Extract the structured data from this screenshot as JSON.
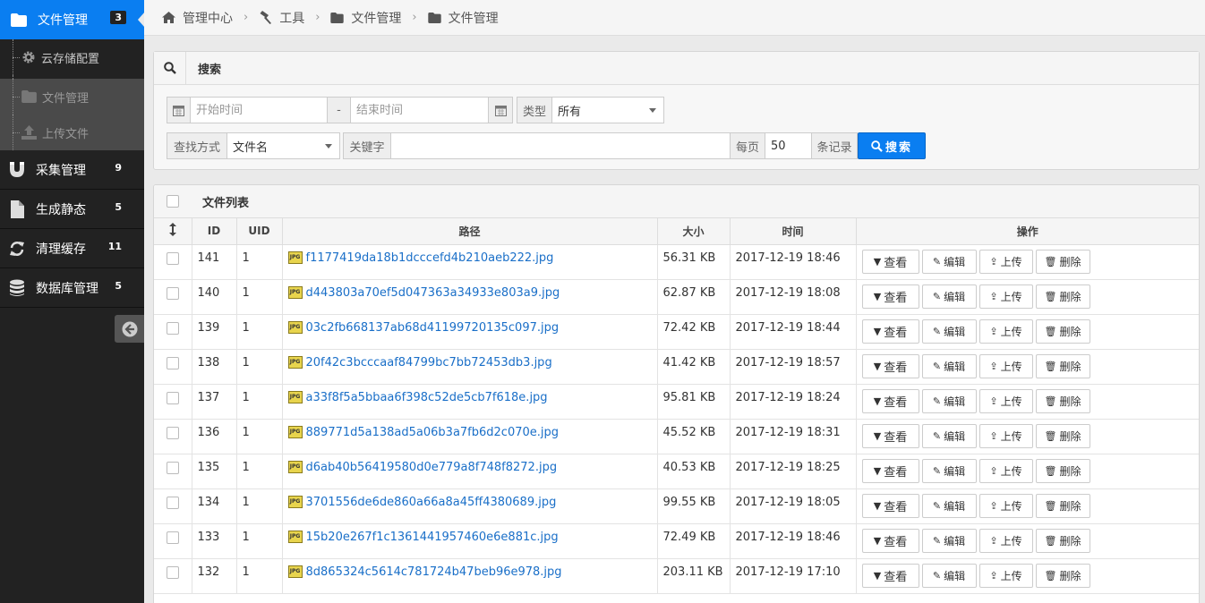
{
  "sidebar": {
    "active": {
      "label": "文件管理",
      "badge": "3"
    },
    "sub_items": [
      {
        "label": "云存储配置",
        "icon": "gear-icon"
      },
      {
        "label": "文件管理",
        "icon": "folder-icon"
      },
      {
        "label": "上传文件",
        "icon": "upload-icon"
      }
    ],
    "items": [
      {
        "label": "采集管理",
        "badge": "9",
        "icon": "magnet-icon"
      },
      {
        "label": "生成静态",
        "badge": "5",
        "icon": "file-icon"
      },
      {
        "label": "清理缓存",
        "badge": "11",
        "icon": "refresh-icon"
      },
      {
        "label": "数据库管理",
        "badge": "5",
        "icon": "database-icon"
      }
    ]
  },
  "breadcrumb": [
    "管理中心",
    "工具",
    "文件管理",
    "文件管理"
  ],
  "search": {
    "title": "搜索",
    "start_placeholder": "开始时间",
    "dash": "-",
    "end_placeholder": "结束时间",
    "type_label": "类型",
    "type_value": "所有",
    "method_label": "查找方式",
    "method_value": "文件名",
    "keyword_label": "关键字",
    "per_page_label": "每页",
    "per_page_value": "50",
    "records_label": "条记录",
    "button": "搜索"
  },
  "list": {
    "title": "文件列表",
    "columns": {
      "id": "ID",
      "uid": "UID",
      "path": "路径",
      "size": "大小",
      "time": "时间",
      "ops": "操作"
    },
    "actions": {
      "view": "查看",
      "edit": "编辑",
      "upload": "上传",
      "delete": "删除"
    },
    "rows": [
      {
        "id": "141",
        "uid": "1",
        "path": "f1177419da18b1dcccefd4b210aeb222.jpg",
        "size": "56.31 KB",
        "time": "2017-12-19 18:46"
      },
      {
        "id": "140",
        "uid": "1",
        "path": "d443803a70ef5d047363a34933e803a9.jpg",
        "size": "62.87 KB",
        "time": "2017-12-19 18:08"
      },
      {
        "id": "139",
        "uid": "1",
        "path": "03c2fb668137ab68d41199720135c097.jpg",
        "size": "72.42 KB",
        "time": "2017-12-19 18:44"
      },
      {
        "id": "138",
        "uid": "1",
        "path": "20f42c3bcccaaf84799bc7bb72453db3.jpg",
        "size": "41.42 KB",
        "time": "2017-12-19 18:57"
      },
      {
        "id": "137",
        "uid": "1",
        "path": "a33f8f5a5bbaa6f398c52de5cb7f618e.jpg",
        "size": "95.81 KB",
        "time": "2017-12-19 18:24"
      },
      {
        "id": "136",
        "uid": "1",
        "path": "889771d5a138ad5a06b3a7fb6d2c070e.jpg",
        "size": "45.52 KB",
        "time": "2017-12-19 18:31"
      },
      {
        "id": "135",
        "uid": "1",
        "path": "d6ab40b56419580d0e779a8f748f8272.jpg",
        "size": "40.53 KB",
        "time": "2017-12-19 18:25"
      },
      {
        "id": "134",
        "uid": "1",
        "path": "3701556de6de860a66a8a45ff4380689.jpg",
        "size": "99.55 KB",
        "time": "2017-12-19 18:05"
      },
      {
        "id": "133",
        "uid": "1",
        "path": "15b20e267f1c1361441957460e6e881c.jpg",
        "size": "72.49 KB",
        "time": "2017-12-19 18:46"
      },
      {
        "id": "132",
        "uid": "1",
        "path": "8d865324c5614c781724b47beb96e978.jpg",
        "size": "203.11 KB",
        "time": "2017-12-19 17:10"
      }
    ]
  }
}
